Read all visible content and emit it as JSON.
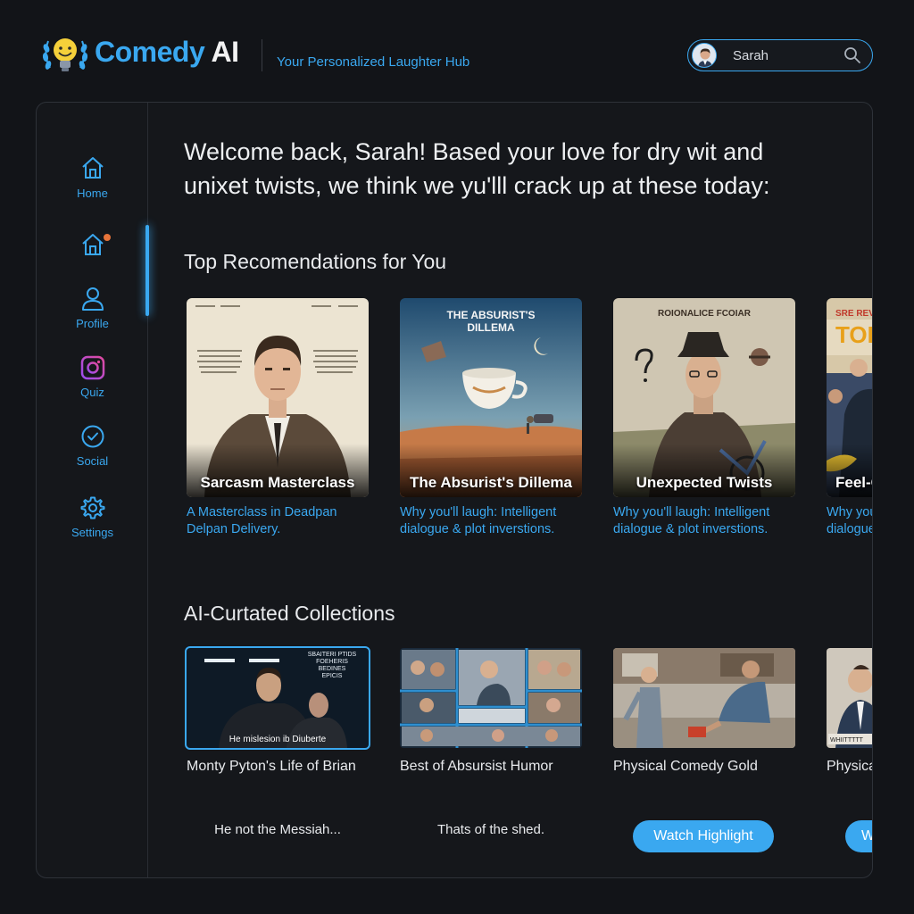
{
  "app": {
    "brand_part1": "Comedy",
    "brand_part2": "AI",
    "tagline": "Your Personalized Laughter Hub",
    "logo_icon": "lightbulb-laurel-icon"
  },
  "user": {
    "name": "Sarah",
    "search_icon": "search-icon"
  },
  "sidebar": {
    "items": [
      {
        "label": "Home",
        "icon": "home-icon"
      },
      {
        "label": "",
        "icon": "home-notification-icon"
      },
      {
        "label": "Profile",
        "icon": "user-icon"
      },
      {
        "label": "Quiz",
        "icon": "camera-icon"
      },
      {
        "label": "Social",
        "icon": "check-circle-icon"
      },
      {
        "label": "Settings",
        "icon": "gear-icon"
      }
    ]
  },
  "welcome": {
    "line1": "Welcome back, Sarah! Based your love for dry wit and",
    "line2": "unixet twists, we think we yu'lll crack up at these today:"
  },
  "recommendations": {
    "title": "Top Recomendations for You",
    "cards": [
      {
        "title": "Sarcasm Masterclass",
        "desc1": "A Masterclass in Deadpan",
        "desc2": "Delpan Delivery."
      },
      {
        "title": "The Absurist's Dillema",
        "poster_text1": "THE ABSURIST'S",
        "poster_text2": "DILLEMA",
        "desc1": "Why you'll laugh: Intelligent",
        "desc2": "dialogue & plot inverstions."
      },
      {
        "title": "Unexpected Twists",
        "poster_text1": "ROIONALICE FCOIAR",
        "desc1": "Why you'll laugh: Intelligent",
        "desc2": "dialogue & plot inverstions."
      },
      {
        "title": "Feel-G",
        "poster_text1": "SRE REVSE",
        "poster_text2": "TOI",
        "desc1": "Why you",
        "desc2": "dialogue"
      }
    ]
  },
  "collections": {
    "title": "AI-Curtated Collections",
    "cards": [
      {
        "title": "Monty Pyton's Life of Brian",
        "caption": "He mislesion ib Diuberte",
        "quote": "He not the Messiah..."
      },
      {
        "title": "Best of Absursist Humor",
        "quote": "Thats of the shed."
      },
      {
        "title": "Physical Comedy Gold",
        "button": "Watch Highlight"
      },
      {
        "title": "Physica",
        "button": "W"
      }
    ]
  },
  "colors": {
    "accent": "#3aa8f0",
    "background": "#121418",
    "panel": "#15171b",
    "notification": "#e8743a"
  }
}
